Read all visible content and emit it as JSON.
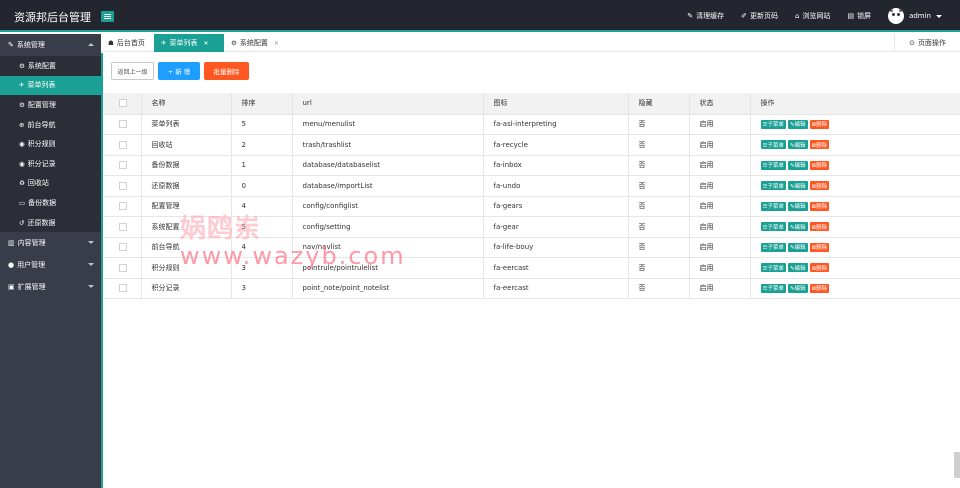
{
  "app": {
    "title": "资源邦后台管理"
  },
  "header": {
    "links": [
      {
        "icon": "eraser-icon",
        "glyph": "✎",
        "label": "清理缓存"
      },
      {
        "icon": "brush-icon",
        "glyph": "✐",
        "label": "更新页码"
      },
      {
        "icon": "home-icon",
        "glyph": "⌂",
        "label": "浏览网站"
      },
      {
        "icon": "lock-screen-icon",
        "glyph": "▤",
        "label": "锁屏"
      }
    ],
    "user": "admin"
  },
  "sidebar": {
    "groups": [
      {
        "label": "系统管理",
        "glyph": "✎",
        "expanded": true,
        "items": [
          {
            "label": "系统配置",
            "glyph": "⚙",
            "active": false
          },
          {
            "label": "菜单列表",
            "glyph": "✈",
            "active": true
          },
          {
            "label": "配置管理",
            "glyph": "⚙",
            "active": false
          },
          {
            "label": "前台导航",
            "glyph": "⊕",
            "active": false
          },
          {
            "label": "积分规则",
            "glyph": "◉",
            "active": false
          },
          {
            "label": "积分记录",
            "glyph": "◉",
            "active": false
          },
          {
            "label": "回收站",
            "glyph": "♻",
            "active": false
          },
          {
            "label": "备份数据",
            "glyph": "▭",
            "active": false
          },
          {
            "label": "还原数据",
            "glyph": "↺",
            "active": false
          }
        ]
      },
      {
        "label": "内容管理",
        "glyph": "▥",
        "expanded": false,
        "items": []
      },
      {
        "label": "用户管理",
        "glyph": "●",
        "expanded": false,
        "items": []
      },
      {
        "label": "扩展管理",
        "glyph": "▣",
        "expanded": false,
        "items": []
      }
    ]
  },
  "tabs": [
    {
      "label": "后台首页",
      "glyph": "☗",
      "active": false,
      "closable": false
    },
    {
      "label": "菜单列表",
      "glyph": "✈",
      "active": true,
      "closable": true
    },
    {
      "label": "系统配置",
      "glyph": "⚙",
      "active": false,
      "closable": true
    }
  ],
  "page_ops": {
    "label": "页面操作",
    "glyph": "⊙"
  },
  "toolbar": {
    "back_label": "返回上一级",
    "add_label": "+ 新 增",
    "batch_delete_label": "批量删除"
  },
  "table": {
    "columns": [
      "",
      "名称",
      "排序",
      "url",
      "图标",
      "隐藏",
      "状态",
      "操作"
    ],
    "rows": [
      {
        "name": "菜单列表",
        "sort": "5",
        "url": "menu/menulist",
        "icon": "fa-asl-interpreting",
        "hidden": "否",
        "status": "启用"
      },
      {
        "name": "回收站",
        "sort": "2",
        "url": "trash/trashlist",
        "icon": "fa-recycle",
        "hidden": "否",
        "status": "启用"
      },
      {
        "name": "备份数据",
        "sort": "1",
        "url": "database/databaselist",
        "icon": "fa-inbox",
        "hidden": "否",
        "status": "启用"
      },
      {
        "name": "还原数据",
        "sort": "0",
        "url": "database/importList",
        "icon": "fa-undo",
        "hidden": "否",
        "status": "启用"
      },
      {
        "name": "配置管理",
        "sort": "4",
        "url": "config/configlist",
        "icon": "fa-gears",
        "hidden": "否",
        "status": "启用"
      },
      {
        "name": "系统配置",
        "sort": "5",
        "url": "config/setting",
        "icon": "fa-gear",
        "hidden": "否",
        "status": "启用"
      },
      {
        "name": "前台导航",
        "sort": "4",
        "url": "nav/navlist",
        "icon": "fa-life-bouy",
        "hidden": "否",
        "status": "启用"
      },
      {
        "name": "积分规则",
        "sort": "3",
        "url": "pointrule/pointrulelist",
        "icon": "fa-eercast",
        "hidden": "否",
        "status": "启用"
      },
      {
        "name": "积分记录",
        "sort": "3",
        "url": "point_note/point_notelist",
        "icon": "fa-eercast",
        "hidden": "否",
        "status": "启用"
      }
    ],
    "row_actions": {
      "sub_menu": "☰子菜单",
      "edit": "✎编辑",
      "delete": "⊠删除"
    }
  },
  "watermark": {
    "cn": "娲鸥岽",
    "url": "www.wazyb.com"
  },
  "colors": {
    "accent": "#1aa094",
    "header_bg": "#23262e",
    "sidebar_bg": "#393d49",
    "add_button": "#1e9fff",
    "delete_button": "#ff5722"
  }
}
